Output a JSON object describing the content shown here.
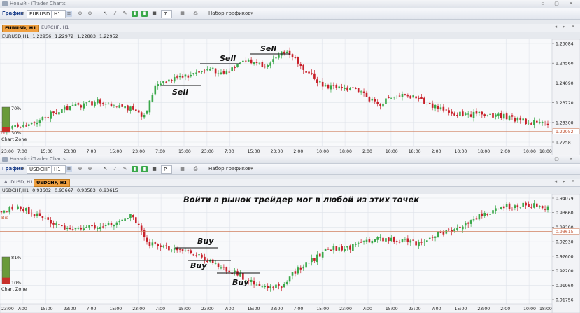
{
  "top_window": {
    "title": "Новый - iTrader Charts",
    "toolbar": {
      "grafik": "График",
      "symbol": "EURUSD",
      "timeframe": "H1",
      "chart_type": "7",
      "chart_sets": "Набор графиков"
    },
    "tabs": [
      {
        "label": "EURUSD, H1",
        "active": true
      },
      {
        "label": "EURCHF, H1",
        "active": false
      }
    ],
    "ohlc": {
      "symbol": "EURUSD,H1",
      "open": "1.22956",
      "high": "1.22972",
      "low": "1.22883",
      "close": "1.22952"
    },
    "price_axis": [
      "1.25084",
      "1.24560",
      "1.24090",
      "1.23720",
      "1.23300",
      "1.22581"
    ],
    "current_price": "1.22952",
    "time_axis": [
      "23:00",
      "7:00",
      "15:00",
      "23:00",
      "7:00",
      "15:00",
      "23:00",
      "7:00",
      "15:00",
      "23:00",
      "7:00",
      "15:00",
      "23:00",
      "2:00",
      "10:00",
      "18:00",
      "2:00",
      "10:00",
      "18:00",
      "2:00",
      "10:00",
      "18:00",
      "2:00",
      "10:00",
      "18:00"
    ],
    "chart_zone": {
      "label": "Chart Zone",
      "top_pct": "70%",
      "bottom_pct": "30%"
    },
    "annotations": [
      {
        "text": "Sell"
      },
      {
        "text": "Sell"
      },
      {
        "text": "Sell"
      }
    ]
  },
  "bottom_window": {
    "title": "Новый - iTrader Charts",
    "toolbar": {
      "grafik": "График",
      "symbol": "USDCHF",
      "timeframe": "H1",
      "chart_type": "P",
      "chart_sets": "Набор графиков"
    },
    "tabs": [
      {
        "label": "AUDUSD, H1",
        "active": false
      },
      {
        "label": "USDCHF, H1",
        "active": true
      }
    ],
    "ohlc": {
      "symbol": "USDCHF,H1",
      "open": "0.93602",
      "high": "0.93667",
      "low": "0.93583",
      "close": "0.93615"
    },
    "price_axis": [
      "0.94079",
      "0.93660",
      "0.93290",
      "0.92930",
      "0.92600",
      "0.92200",
      "0.91960",
      "0.91756"
    ],
    "current_price": "0.93615",
    "left_price_tag": "Bid",
    "time_axis": [
      "23:00",
      "7:00",
      "15:00",
      "23:00",
      "7:00",
      "15:00",
      "23:00",
      "7:00",
      "15:00",
      "23:00",
      "7:00",
      "15:00",
      "23:00",
      "7:00",
      "15:00",
      "23:00",
      "7:00",
      "15:00",
      "23:00",
      "7:00",
      "15:00",
      "23:00",
      "2:00",
      "10:00",
      "18:00"
    ],
    "chart_zone": {
      "label": "Chart Zone",
      "top_pct": "81%",
      "bottom_pct": "10%"
    },
    "headline": "Войти в рынок трейдер мог в любой из этих точек",
    "annotations": [
      {
        "text": "Buy"
      },
      {
        "text": "Buy"
      },
      {
        "text": "Buy"
      }
    ]
  },
  "colors": {
    "bull": "#3aa84a",
    "bear": "#c8202a",
    "price_line": "#d08060",
    "tab_active": "#f0a040"
  }
}
